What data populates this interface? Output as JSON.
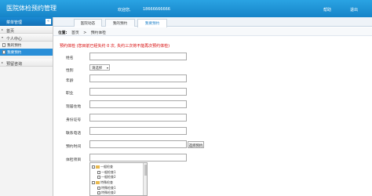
{
  "header": {
    "title": "医院体检预约管理",
    "welcome": "欢迎您,",
    "phone": "18666666666",
    "help": "帮助",
    "logout": "退出"
  },
  "sidebar": {
    "title": "菜单管理",
    "toggle": "«",
    "sections": [
      {
        "label": "首页"
      },
      {
        "label": "个人中心"
      },
      {
        "label": "预留咨询"
      }
    ],
    "items": [
      {
        "label": "我的预约"
      },
      {
        "label": "我要预约"
      }
    ]
  },
  "tabs": [
    {
      "label": "医院动态"
    },
    {
      "label": "我的预约"
    },
    {
      "label": "我要预约"
    }
  ],
  "breadcrumb": {
    "prefix": "位置:",
    "home": "首页",
    "sep": ">",
    "current": "预约体检"
  },
  "notice": "预约体检 (您目前已经失约 0 次, 失约三次将不能再次预约体检)",
  "form": {
    "name_label": "姓名",
    "gender_label": "性别",
    "gender_value": "请选择",
    "age_label": "年龄",
    "job_label": "职业",
    "address_label": "现居住地",
    "id_label": "身份证号",
    "contact_label": "联系电话",
    "time_label": "预约时间",
    "query_button": "选择预约",
    "items_label": "体检项目"
  },
  "tree": {
    "nodes": [
      {
        "label": "一般检查"
      },
      {
        "label": "一般检查1"
      },
      {
        "label": "一般检查2"
      },
      {
        "label": "特殊检查"
      },
      {
        "label": "特殊检查1"
      },
      {
        "label": "特殊检查2"
      }
    ]
  }
}
